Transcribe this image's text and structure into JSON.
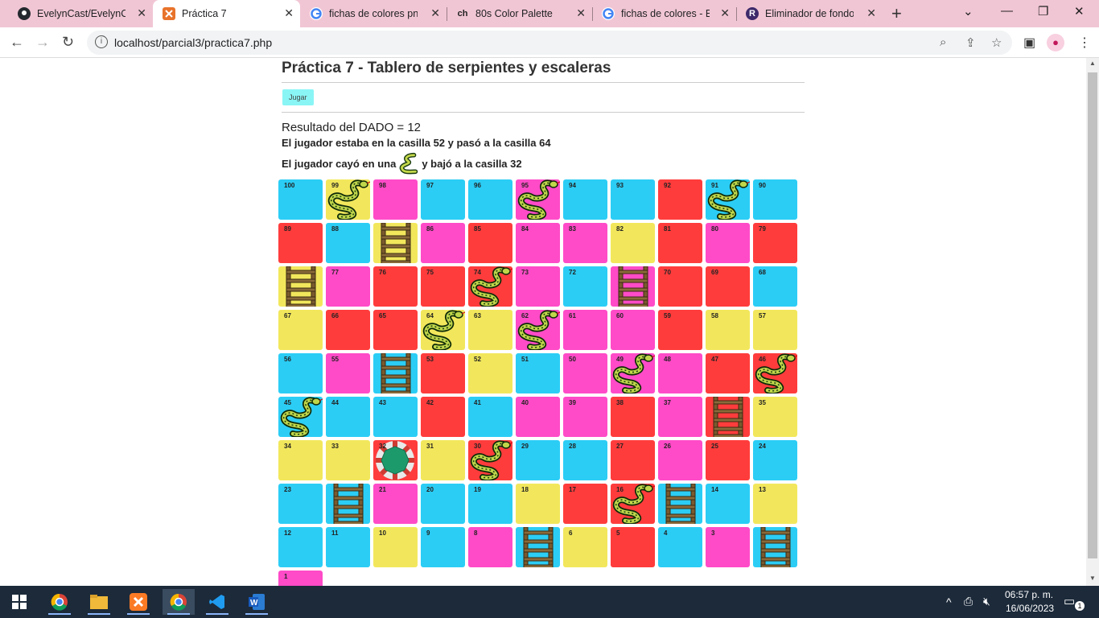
{
  "browser": {
    "tabs": [
      {
        "title": "EvelynCast/EvelynCast",
        "icon": "github-icon",
        "active": false
      },
      {
        "title": "Práctica 7",
        "icon": "xampp-icon",
        "active": true
      },
      {
        "title": "fichas de colores png",
        "icon": "google-icon",
        "active": false
      },
      {
        "title": "80s Color Palette",
        "icon": "ch-icon",
        "icon_text": "ch",
        "active": false
      },
      {
        "title": "fichas de colores - Bús",
        "icon": "google-icon",
        "active": false
      },
      {
        "title": "Eliminador de fondos",
        "icon": "removebg-icon",
        "icon_text": "R",
        "active": false
      }
    ],
    "url": "localhost/parcial3/practica7.php"
  },
  "page": {
    "title": "Práctica 7 - Tablero de serpientes y escaleras",
    "play_button": "Jugar",
    "dice_result": "Resultado del DADO = 12",
    "move_text": "El jugador estaba en la casilla 52 y pasó a la casilla 64",
    "event_prefix": "El jugador cayó en una",
    "event_suffix": "y bajó a la casilla 32"
  },
  "colors": {
    "blue": "#2bcdf5",
    "pink": "#ff4bc8",
    "yellow": "#f2e75c",
    "red": "#ff3c3c"
  },
  "board": [
    [
      {
        "n": "100",
        "c": "blue"
      },
      {
        "n": "99",
        "c": "yellow",
        "i": "snake"
      },
      {
        "n": "98",
        "c": "pink"
      },
      {
        "n": "97",
        "c": "blue"
      },
      {
        "n": "96",
        "c": "blue"
      },
      {
        "n": "95",
        "c": "pink",
        "i": "snake"
      },
      {
        "n": "94",
        "c": "blue"
      },
      {
        "n": "93",
        "c": "blue"
      },
      {
        "n": "92",
        "c": "red"
      },
      {
        "n": "91",
        "c": "blue",
        "i": "snake"
      },
      {
        "n": "90",
        "c": "blue"
      }
    ],
    [
      {
        "n": "89",
        "c": "red"
      },
      {
        "n": "88",
        "c": "blue"
      },
      {
        "n": "",
        "c": "yellow",
        "i": "ladder"
      },
      {
        "n": "86",
        "c": "pink"
      },
      {
        "n": "85",
        "c": "red"
      },
      {
        "n": "84",
        "c": "pink"
      },
      {
        "n": "83",
        "c": "pink"
      },
      {
        "n": "82",
        "c": "yellow"
      },
      {
        "n": "81",
        "c": "red"
      },
      {
        "n": "80",
        "c": "pink"
      },
      {
        "n": "79",
        "c": "red"
      }
    ],
    [
      {
        "n": "",
        "c": "yellow",
        "i": "ladder"
      },
      {
        "n": "77",
        "c": "pink"
      },
      {
        "n": "76",
        "c": "red"
      },
      {
        "n": "75",
        "c": "red"
      },
      {
        "n": "74",
        "c": "red",
        "i": "snake"
      },
      {
        "n": "73",
        "c": "pink"
      },
      {
        "n": "72",
        "c": "blue"
      },
      {
        "n": "",
        "c": "pink",
        "i": "ladder"
      },
      {
        "n": "70",
        "c": "red"
      },
      {
        "n": "69",
        "c": "red"
      },
      {
        "n": "68",
        "c": "blue"
      }
    ],
    [
      {
        "n": "67",
        "c": "yellow"
      },
      {
        "n": "66",
        "c": "red"
      },
      {
        "n": "65",
        "c": "red"
      },
      {
        "n": "64",
        "c": "yellow",
        "i": "snake"
      },
      {
        "n": "63",
        "c": "yellow"
      },
      {
        "n": "62",
        "c": "pink",
        "i": "snake"
      },
      {
        "n": "61",
        "c": "pink"
      },
      {
        "n": "60",
        "c": "pink"
      },
      {
        "n": "59",
        "c": "red"
      },
      {
        "n": "58",
        "c": "yellow"
      },
      {
        "n": "57",
        "c": "yellow"
      }
    ],
    [
      {
        "n": "56",
        "c": "blue"
      },
      {
        "n": "55",
        "c": "pink"
      },
      {
        "n": "",
        "c": "blue",
        "i": "ladder"
      },
      {
        "n": "53",
        "c": "red"
      },
      {
        "n": "52",
        "c": "yellow"
      },
      {
        "n": "51",
        "c": "blue"
      },
      {
        "n": "50",
        "c": "pink"
      },
      {
        "n": "49",
        "c": "pink",
        "i": "snake"
      },
      {
        "n": "48",
        "c": "pink"
      },
      {
        "n": "47",
        "c": "red"
      },
      {
        "n": "46",
        "c": "red",
        "i": "snake"
      }
    ],
    [
      {
        "n": "45",
        "c": "blue",
        "i": "snake"
      },
      {
        "n": "44",
        "c": "blue"
      },
      {
        "n": "43",
        "c": "blue"
      },
      {
        "n": "42",
        "c": "red"
      },
      {
        "n": "41",
        "c": "blue"
      },
      {
        "n": "40",
        "c": "pink"
      },
      {
        "n": "39",
        "c": "pink"
      },
      {
        "n": "38",
        "c": "red"
      },
      {
        "n": "37",
        "c": "pink"
      },
      {
        "n": "",
        "c": "red",
        "i": "ladder"
      },
      {
        "n": "35",
        "c": "yellow"
      }
    ],
    [
      {
        "n": "34",
        "c": "yellow"
      },
      {
        "n": "33",
        "c": "yellow"
      },
      {
        "n": "32",
        "c": "red",
        "i": "chip"
      },
      {
        "n": "31",
        "c": "yellow"
      },
      {
        "n": "30",
        "c": "red",
        "i": "snake"
      },
      {
        "n": "29",
        "c": "blue"
      },
      {
        "n": "28",
        "c": "blue"
      },
      {
        "n": "27",
        "c": "red"
      },
      {
        "n": "26",
        "c": "pink"
      },
      {
        "n": "25",
        "c": "red"
      },
      {
        "n": "24",
        "c": "blue"
      }
    ],
    [
      {
        "n": "23",
        "c": "blue"
      },
      {
        "n": "",
        "c": "blue",
        "i": "ladder"
      },
      {
        "n": "21",
        "c": "pink"
      },
      {
        "n": "20",
        "c": "blue"
      },
      {
        "n": "19",
        "c": "blue"
      },
      {
        "n": "18",
        "c": "yellow"
      },
      {
        "n": "17",
        "c": "red"
      },
      {
        "n": "16",
        "c": "red",
        "i": "snake"
      },
      {
        "n": "",
        "c": "blue",
        "i": "ladder"
      },
      {
        "n": "14",
        "c": "blue"
      },
      {
        "n": "13",
        "c": "yellow"
      }
    ],
    [
      {
        "n": "12",
        "c": "blue"
      },
      {
        "n": "11",
        "c": "blue"
      },
      {
        "n": "10",
        "c": "yellow"
      },
      {
        "n": "9",
        "c": "blue"
      },
      {
        "n": "8",
        "c": "pink"
      },
      {
        "n": "",
        "c": "blue",
        "i": "ladder"
      },
      {
        "n": "6",
        "c": "yellow"
      },
      {
        "n": "5",
        "c": "red"
      },
      {
        "n": "4",
        "c": "blue"
      },
      {
        "n": "3",
        "c": "pink"
      },
      {
        "n": "",
        "c": "blue",
        "i": "ladder"
      }
    ],
    [
      {
        "n": "1",
        "c": "pink"
      }
    ]
  ],
  "taskbar": {
    "apps": [
      "chrome-icon",
      "file-explorer-icon",
      "xampp-icon",
      "chrome-profile-icon",
      "vscode-icon",
      "word-icon"
    ],
    "time": "06:57 p. m.",
    "date": "16/06/2023",
    "notifications": "1"
  }
}
